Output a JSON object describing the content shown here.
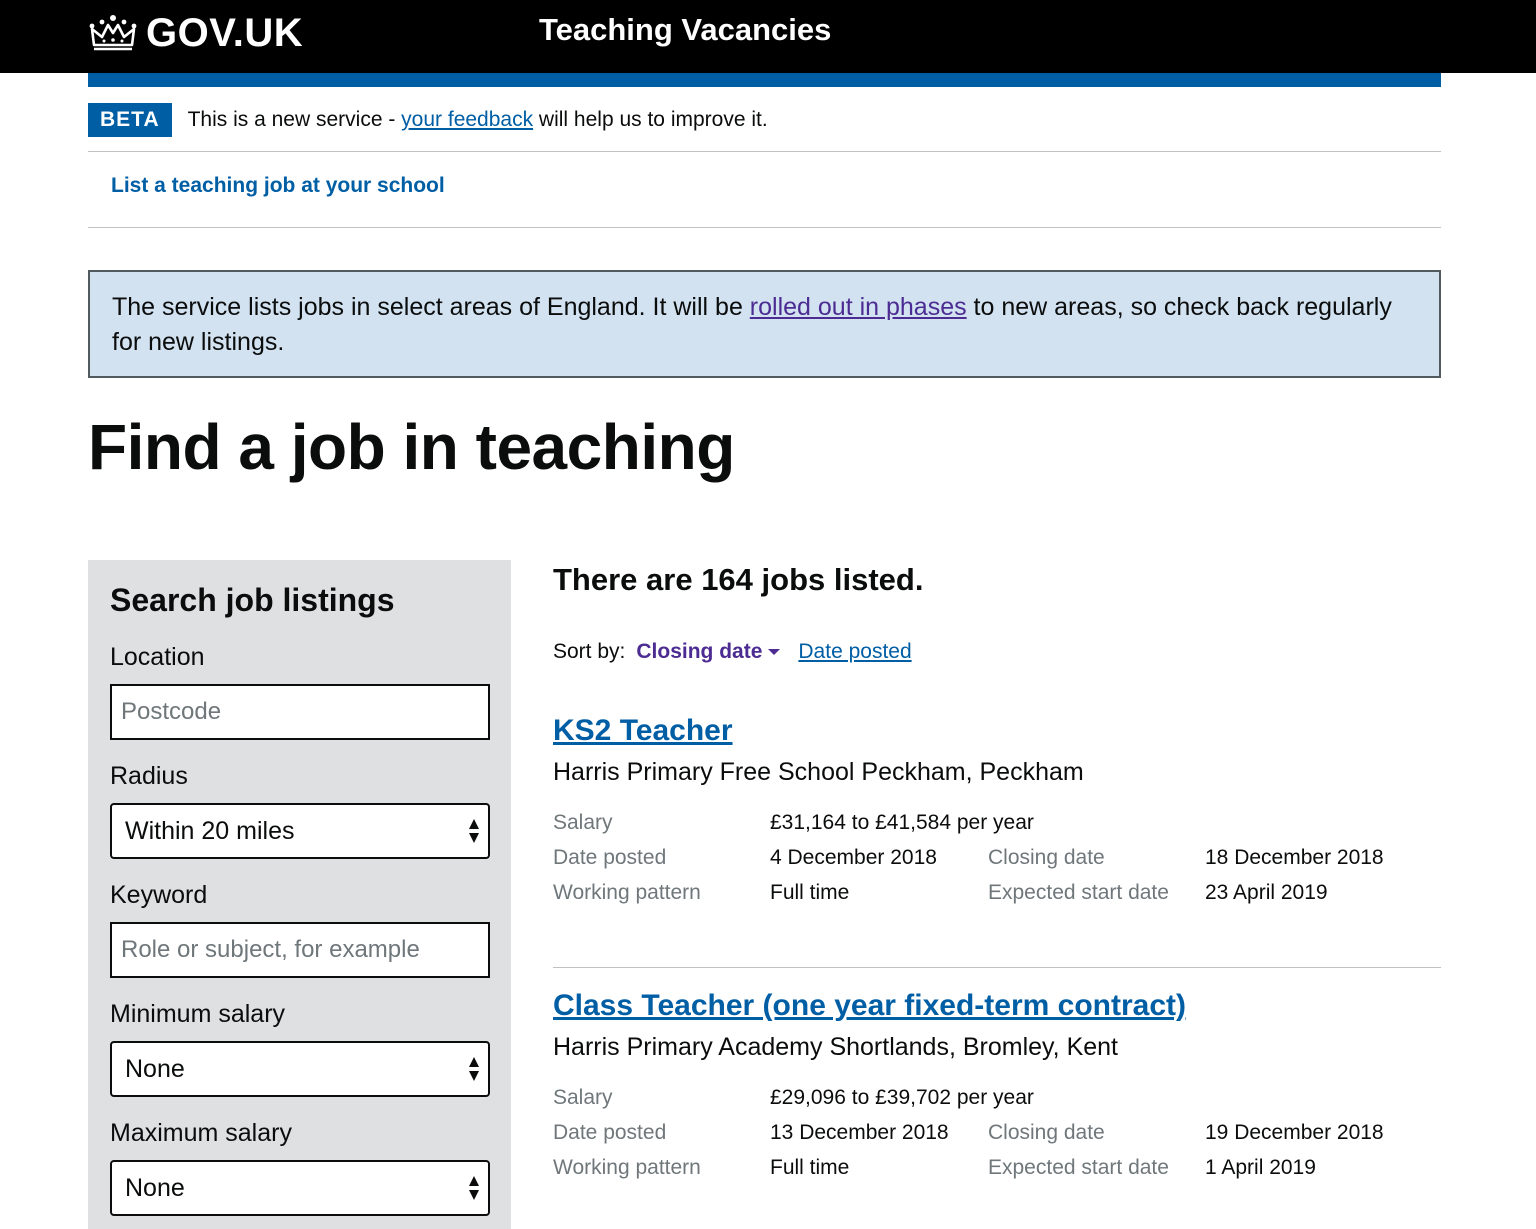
{
  "header": {
    "logo_text": "GOV.UK",
    "service_name": "Teaching Vacancies"
  },
  "beta": {
    "tag": "BETA",
    "text_before": "This is a new service - ",
    "link": "your feedback",
    "text_after": " will help us to improve it."
  },
  "nav": {
    "list_job_link": "List a teaching job at your school"
  },
  "notice": {
    "text_before": "The service lists jobs in select areas of England. It will be ",
    "link": "rolled out in phases",
    "text_after": " to new areas, so check back regularly for new listings."
  },
  "page": {
    "title": "Find a job in teaching"
  },
  "search": {
    "heading": "Search job listings",
    "location_label": "Location",
    "location_placeholder": "Postcode",
    "radius_label": "Radius",
    "radius_value": "Within 20 miles",
    "keyword_label": "Keyword",
    "keyword_placeholder": "Role or subject, for example",
    "min_salary_label": "Minimum salary",
    "min_salary_value": "None",
    "max_salary_label": "Maximum salary",
    "max_salary_value": "None"
  },
  "results": {
    "count_text": "There are 164 jobs listed.",
    "sort_label": "Sort by:",
    "sort_active": "Closing date",
    "sort_option": "Date posted"
  },
  "meta_labels": {
    "salary": "Salary",
    "date_posted": "Date posted",
    "working_pattern": "Working pattern",
    "closing_date": "Closing date",
    "start_date": "Expected start date"
  },
  "jobs": [
    {
      "title": "KS2 Teacher",
      "school": "Harris Primary Free School Peckham, Peckham",
      "salary": "£31,164 to £41,584 per year",
      "date_posted": "4 December 2018",
      "working_pattern": "Full time",
      "closing_date": "18 December 2018",
      "start_date": "23 April 2019"
    },
    {
      "title": "Class Teacher (one year fixed-term contract)",
      "school": "Harris Primary Academy Shortlands, Bromley, Kent",
      "salary": "£29,096 to £39,702 per year",
      "date_posted": "13 December 2018",
      "working_pattern": "Full time",
      "closing_date": "19 December 2018",
      "start_date": "1 April 2019"
    }
  ],
  "colors": {
    "header_bg": "#000000",
    "brand_blue": "#005ea5",
    "visited_purple": "#4c2c92",
    "notice_bg": "#d2e2f1",
    "sidebar_bg": "#dee0e2",
    "secondary_text": "#6f777b"
  }
}
